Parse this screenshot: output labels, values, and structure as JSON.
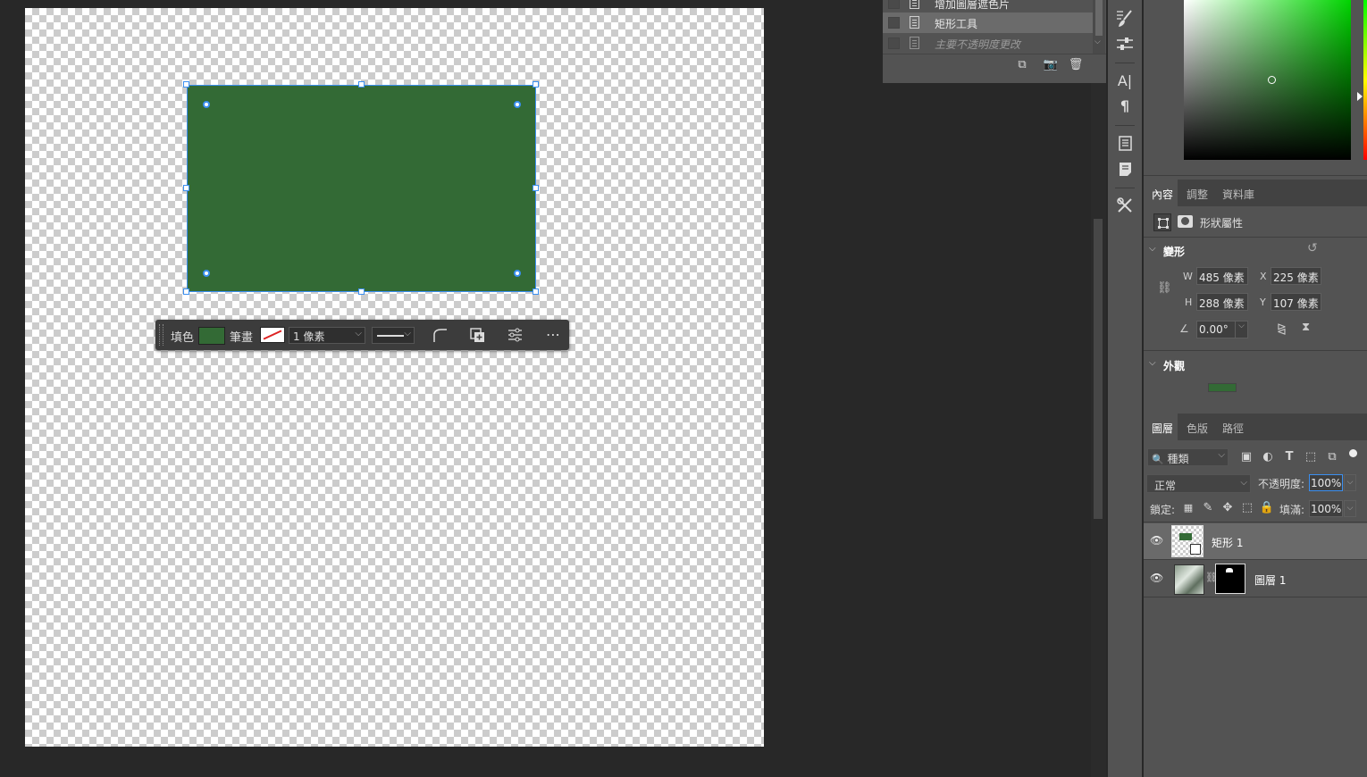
{
  "history": {
    "items": [
      {
        "label": "增加圖層遮色片",
        "italic": false
      },
      {
        "label": "矩形工具",
        "italic": false
      },
      {
        "label": "主要不透明度更改",
        "italic": true
      }
    ]
  },
  "contextbar": {
    "fill_label": "填色",
    "stroke_label": "筆畫",
    "stroke_width": "1 像素",
    "fill_color": "#336a35"
  },
  "properties": {
    "tabs": [
      "內容",
      "調整",
      "資料庫"
    ],
    "shape_props_label": "形狀屬性",
    "transform_title": "變形",
    "w_label": "W",
    "w_value": "485 像素",
    "h_label": "H",
    "h_value": "288 像素",
    "x_label": "X",
    "x_value": "225 像素",
    "y_label": "Y",
    "y_value": "107 像素",
    "angle_value": "0.00°",
    "appearance_title": "外觀"
  },
  "layers": {
    "tabs": [
      "圖層",
      "色版",
      "路徑"
    ],
    "filter_kind": "種類",
    "blend_mode": "正常",
    "opacity_label": "不透明度:",
    "opacity_value": "100%",
    "lock_label": "鎖定:",
    "fill_label": "填滿:",
    "fill_value": "100%",
    "rows": [
      {
        "name": "矩形 1"
      },
      {
        "name": "圖層 1"
      }
    ]
  },
  "icons": {
    "strip": [
      "brush-settings-icon",
      "adjust-sliders-icon",
      "character-icon",
      "paragraph-icon",
      "glyph-panel-icon",
      "notes-icon",
      "tools-icon"
    ]
  }
}
